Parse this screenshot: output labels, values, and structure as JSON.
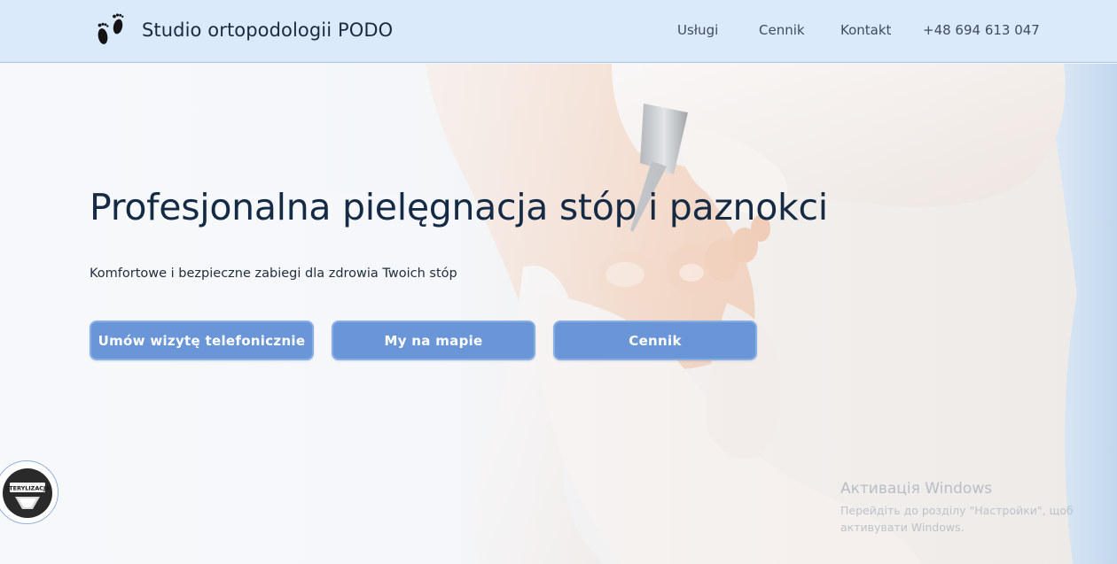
{
  "header": {
    "brand": "Studio ortopodologii PODO",
    "logo_icon": "footprints-icon",
    "nav": [
      "Usługi",
      "Cennik",
      "Kontakt",
      "+48 694 613 047"
    ]
  },
  "hero": {
    "headline": "Profesjonalna pielęgnacja stóp i paznokci",
    "subline": "Komfortowe i bezpieczne zabiegi dla zdrowia Twoich stóp",
    "buttons": [
      "Umów wizytę telefonicznie",
      "My na mapie",
      "Cennik"
    ],
    "badge_text": "STERYLIZACJA"
  },
  "watermark": {
    "title": "Активація Windows",
    "subtitle": "Перейдіть до розділу \"Настройки\", щоб активувати Windows."
  },
  "colors": {
    "header_bg": "#dbeafb",
    "button_bg": "#6a96d8",
    "headline": "#152a44"
  }
}
